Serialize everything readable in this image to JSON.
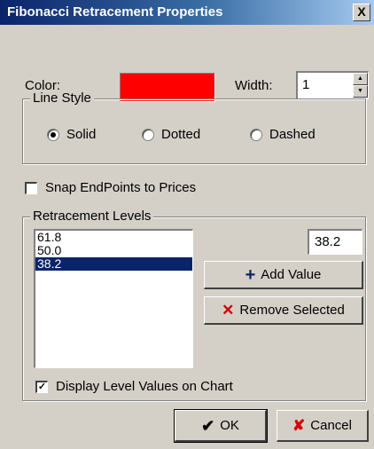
{
  "window": {
    "title": "Fibonacci Retracement Properties",
    "close_label": "X"
  },
  "color": {
    "label": "Color:",
    "value_hex": "#ff0000"
  },
  "width": {
    "label": "Width:",
    "value": "1"
  },
  "line_style": {
    "title": "Line Style",
    "options": [
      "Solid",
      "Dotted",
      "Dashed"
    ],
    "selected": "Solid"
  },
  "snap": {
    "label": "Snap EndPoints to Prices",
    "checked": false
  },
  "retracement": {
    "title": "Retracement Levels",
    "levels": [
      "61.8",
      "50.0",
      "38.2"
    ],
    "selected": "38.2",
    "input_value": "38.2",
    "add_label": "Add Value",
    "remove_label": "Remove Selected",
    "display_values_label": "Display Level Values on Chart",
    "display_values_checked": true
  },
  "buttons": {
    "ok_label": "OK",
    "cancel_label": "Cancel"
  },
  "colors": {
    "title_bar_start": "#0a246a",
    "selection": "#0a246a",
    "face": "#d4d0c8",
    "remove_icon": "#d40000"
  },
  "icons": [
    "add-icon",
    "remove-icon",
    "ok-checkmark-icon",
    "cancel-x-icon",
    "close-icon"
  ]
}
